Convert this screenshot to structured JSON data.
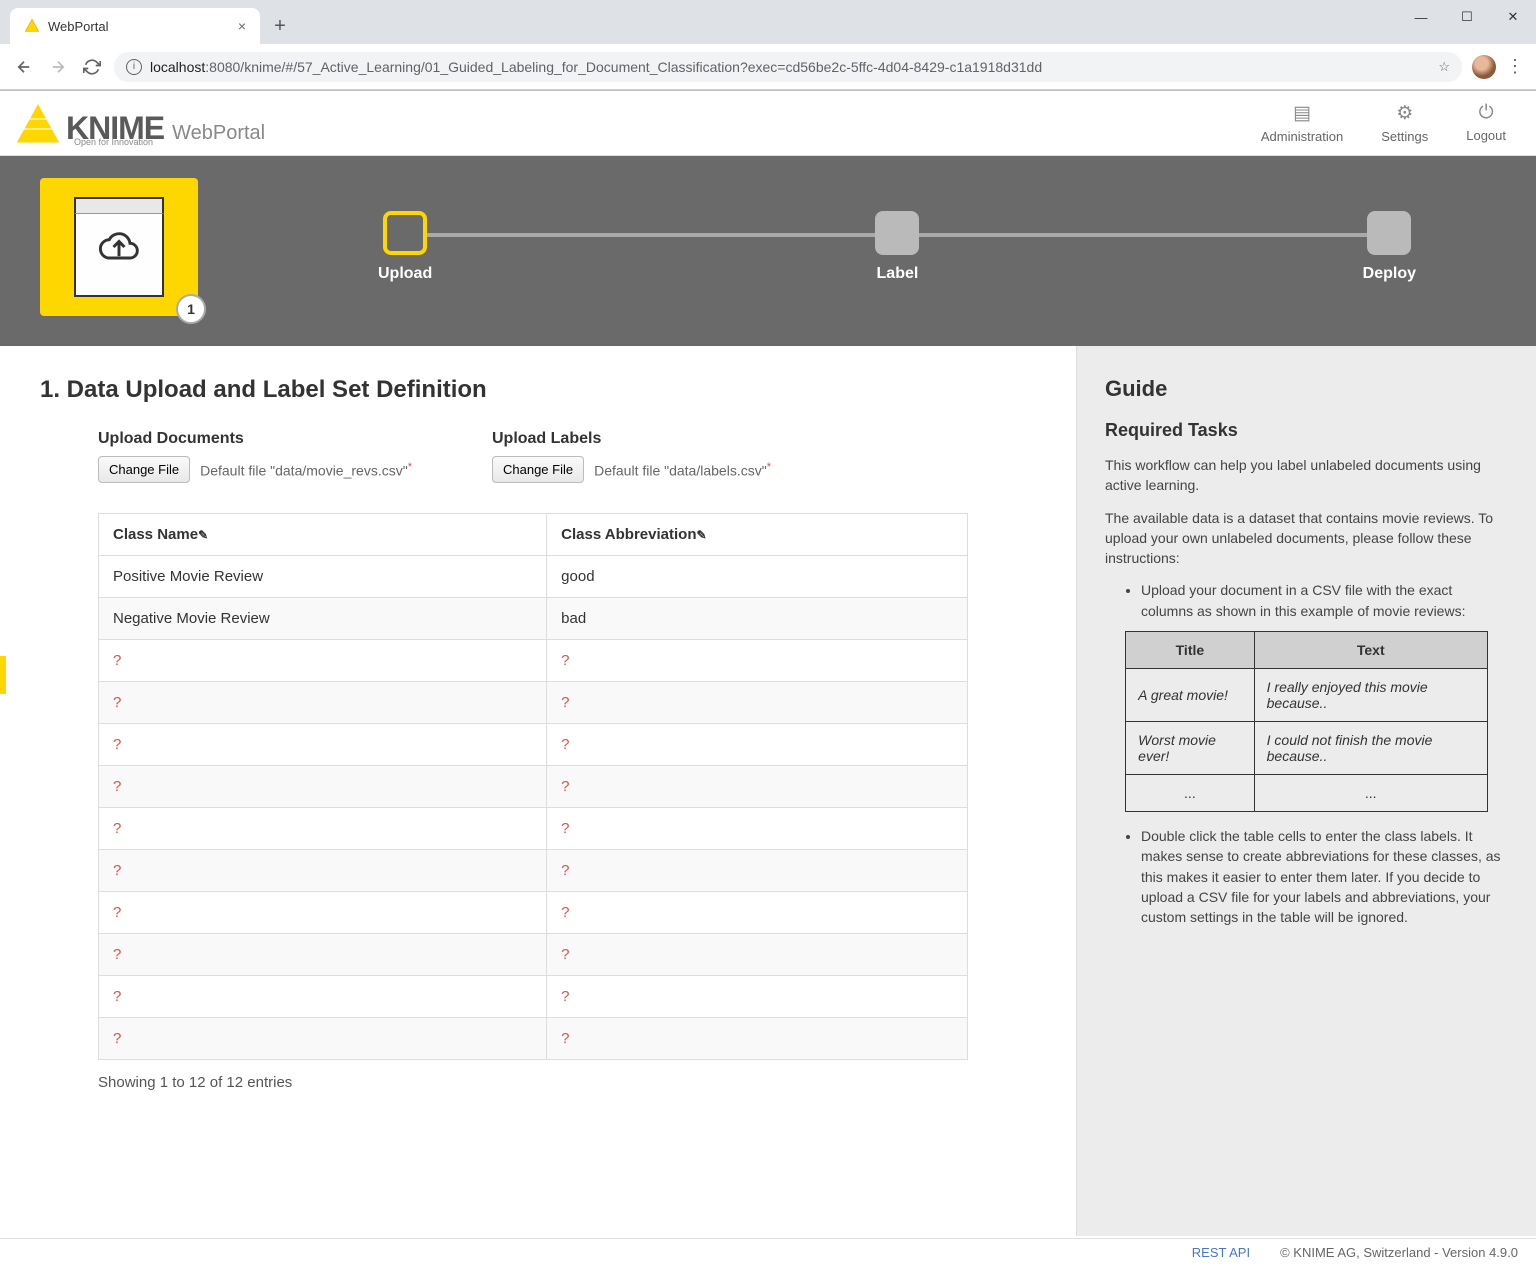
{
  "browser": {
    "tab_title": "WebPortal",
    "url_host": "localhost",
    "url_port_path": ":8080/knime/#/57_Active_Learning/01_Guided_Labeling_for_Document_Classification?exec=cd56be2c-5ffc-4d04-8429-c1a1918d31dd"
  },
  "header": {
    "brand": "KNIME",
    "brand_tagline": "Open for Innovation",
    "brand_sub": "WebPortal",
    "actions": {
      "administration": "Administration",
      "settings": "Settings",
      "logout": "Logout"
    }
  },
  "stepper": {
    "badge": "1",
    "steps": [
      {
        "label": "Upload",
        "active": true
      },
      {
        "label": "Label",
        "active": false
      },
      {
        "label": "Deploy",
        "active": false
      }
    ]
  },
  "main": {
    "title": "1. Data Upload and Label Set Definition",
    "upload_documents": {
      "heading": "Upload Documents",
      "button": "Change File",
      "default_text": "Default file \"data/movie_revs.csv\""
    },
    "upload_labels": {
      "heading": "Upload Labels",
      "button": "Change File",
      "default_text": "Default file \"data/labels.csv\""
    },
    "table": {
      "col1": "Class Name",
      "col2": "Class Abbreviation",
      "rows": [
        {
          "name": "Positive Movie Review",
          "abbrev": "good"
        },
        {
          "name": "Negative Movie Review",
          "abbrev": "bad"
        },
        {
          "name": "?",
          "abbrev": "?"
        },
        {
          "name": "?",
          "abbrev": "?"
        },
        {
          "name": "?",
          "abbrev": "?"
        },
        {
          "name": "?",
          "abbrev": "?"
        },
        {
          "name": "?",
          "abbrev": "?"
        },
        {
          "name": "?",
          "abbrev": "?"
        },
        {
          "name": "?",
          "abbrev": "?"
        },
        {
          "name": "?",
          "abbrev": "?"
        },
        {
          "name": "?",
          "abbrev": "?"
        },
        {
          "name": "?",
          "abbrev": "?"
        }
      ],
      "footer": "Showing 1 to 12 of 12 entries"
    }
  },
  "guide": {
    "title": "Guide",
    "subtitle": "Required Tasks",
    "p1": "This workflow can help you label unlabeled documents using active learning.",
    "p2": "The available data is a dataset that contains movie reviews. To upload your own unlabeled documents, please follow these instructions:",
    "li1": "Upload your document in a CSV file with the exact columns as shown in this example of movie reviews:",
    "example_header_title": "Title",
    "example_header_text": "Text",
    "example_rows": [
      {
        "title": "A great movie!",
        "text": "I really enjoyed this movie because.."
      },
      {
        "title": "Worst movie ever!",
        "text": "I could not finish the movie because.."
      },
      {
        "title": "...",
        "text": "..."
      }
    ],
    "li2": "Double click the table cells to enter the class labels. It makes sense to create abbreviations for these classes, as this makes it easier to enter them later. If you decide to upload a CSV file for your labels and abbreviations, your custom settings in the table will be ignored."
  },
  "footer": {
    "rest_api": "REST API",
    "copyright": "© KNIME AG, Switzerland - Version 4.9.0"
  }
}
